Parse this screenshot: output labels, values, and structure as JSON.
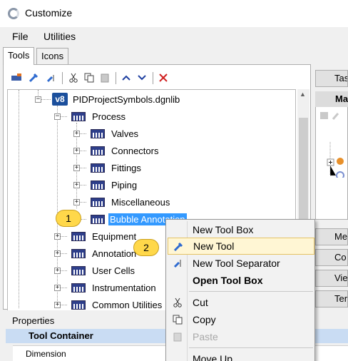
{
  "window": {
    "title": "Customize"
  },
  "menu": {
    "items": [
      "File",
      "Utilities"
    ]
  },
  "tabs": [
    {
      "label": "Tools",
      "active": true
    },
    {
      "label": "Icons",
      "active": false
    }
  ],
  "tree": {
    "root": "PIDProjectSymbols.dgnlib",
    "process": "Process",
    "process_children": [
      "Valves",
      "Connectors",
      "Fittings",
      "Piping",
      "Miscellaneous"
    ],
    "selected": "Bubble Annotation",
    "siblings": [
      "Equipment",
      "Annotation",
      "User Cells",
      "Instrumentation",
      "Common Utilities"
    ]
  },
  "badges": {
    "first": "1",
    "second": "2"
  },
  "right_panel": {
    "top_button": "Tas",
    "header": "Ma",
    "buttons": [
      "Me",
      "Co",
      "Vie",
      "Ter"
    ]
  },
  "properties": {
    "title": "Properties",
    "header": "Tool Container",
    "row_label": "Dimension"
  },
  "context_menu": {
    "items": [
      {
        "label": "New Tool Box",
        "icon": "new-tool-box-icon"
      },
      {
        "label": "New Tool",
        "icon": "new-tool-icon",
        "highlighted": true
      },
      {
        "label": "New Tool Separator",
        "icon": "new-tool-separator-icon"
      },
      {
        "label": "Open Tool Box",
        "bold": true
      },
      {
        "label": "Cut",
        "icon": "cut-icon"
      },
      {
        "label": "Copy",
        "icon": "copy-icon"
      },
      {
        "label": "Paste",
        "icon": "paste-icon",
        "disabled": true
      },
      {
        "label": "Move Up"
      }
    ]
  },
  "colors": {
    "selection": "#3399ff",
    "badge": "#ffd84a",
    "menu_highlight": "#fff6d4",
    "properties_header": "#c9dcf3"
  }
}
